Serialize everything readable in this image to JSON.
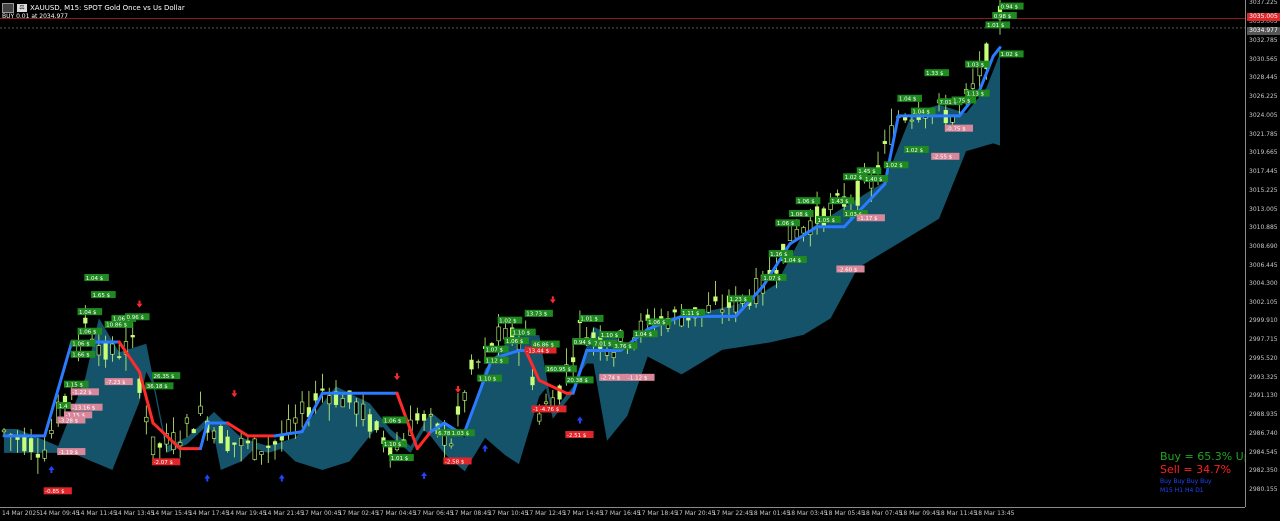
{
  "window": {
    "symbol_title": "XAUUSD, M15:  SPOT Gold Once vs Us Dollar",
    "order_line": "BUY 0.01 at 2034.977"
  },
  "price_axis": {
    "ticks": [
      "3037.225",
      "3035.005",
      "3032.785",
      "3030.565",
      "3028.445",
      "3026.225",
      "3024.005",
      "3021.785",
      "3019.665",
      "3017.445",
      "3015.225",
      "3013.005",
      "3010.885",
      "3008.690",
      "3006.445",
      "3004.300",
      "3002.105",
      "2999.910",
      "2997.715",
      "2995.520",
      "2993.325",
      "2991.130",
      "2988.935",
      "2986.740",
      "2984.545",
      "2982.350",
      "2980.155"
    ],
    "bid_tag": "3035.005",
    "ask_tag": "3034.977",
    "bid_color": "#e0262a",
    "ask_color": "#555555"
  },
  "time_axis": {
    "ticks": [
      "14 Mar 2025",
      "14 Mar 09:45",
      "14 Mar 11:45",
      "14 Mar 13:45",
      "14 Mar 15:45",
      "14 Mar 17:45",
      "14 Mar 19:45",
      "14 Mar 21:45",
      "17 Mar 00:45",
      "17 Mar 02:45",
      "17 Mar 04:45",
      "17 Mar 06:45",
      "17 Mar 08:45",
      "17 Mar 10:45",
      "17 Mar 12:45",
      "17 Mar 14:45",
      "17 Mar 16:45",
      "17 Mar 18:45",
      "17 Mar 20:45",
      "17 Mar 22:45",
      "18 Mar 01:45",
      "18 Mar 03:45",
      "18 Mar 05:45",
      "18 Mar 07:45",
      "18 Mar 09:45",
      "18 Mar 11:45",
      "18 Mar 13:45"
    ]
  },
  "stats": {
    "buy": "Buy = 65.3% Up",
    "sell": "Sell = 34.7%",
    "tf_row1": "Buy  Buy  Buy  Buy",
    "tf_row2": "M15  H1   H4   D1"
  },
  "colors": {
    "buy_label": "#1f8a1f",
    "sell_label": "#e0262a",
    "sell_label_light": "#d8889a",
    "trend_up": "#2a7bff",
    "trend_down": "#ff2a2a",
    "cloud": "#1b6f8e",
    "candle": "#c8ff78",
    "arrow_up": "#2244ff",
    "arrow_down": "#ff2a2a"
  },
  "price_scale": {
    "min": 2980.155,
    "max": 3037.225
  },
  "chart_labels": [
    {
      "text": "1.04 $",
      "kind": "buy",
      "price": 3005.0,
      "t": 12
    },
    {
      "text": "1.65 $",
      "kind": "buy",
      "price": 3003.0,
      "t": 13
    },
    {
      "text": "1.04 $",
      "kind": "buy",
      "price": 3001.0,
      "t": 11
    },
    {
      "text": "1.06 $",
      "kind": "buy",
      "price": 2998.7,
      "t": 11
    },
    {
      "text": "1.06 $",
      "kind": "buy",
      "price": 2997.3,
      "t": 10
    },
    {
      "text": "1.66 $",
      "kind": "buy",
      "price": 2996.0,
      "t": 10
    },
    {
      "text": "1.15 $",
      "kind": "buy",
      "price": 2992.5,
      "t": 9
    },
    {
      "text": "-1.22 $",
      "kind": "sell_light",
      "price": 2991.6,
      "t": 10
    },
    {
      "text": "1.4",
      "kind": "buy",
      "price": 2990.0,
      "t": 8
    },
    {
      "text": "-13.16 $",
      "kind": "sell_light",
      "price": 2989.8,
      "t": 10
    },
    {
      "text": "-1.15 $",
      "kind": "sell_light",
      "price": 2988.9,
      "t": 9
    },
    {
      "text": "-3.28 $",
      "kind": "sell_light",
      "price": 2988.3,
      "t": 8
    },
    {
      "text": "-1.19 $",
      "kind": "sell_light",
      "price": 2984.6,
      "t": 8
    },
    {
      "text": "-0.85 $",
      "kind": "sell",
      "price": 2980.0,
      "t": 6
    },
    {
      "text": "1.06 $",
      "kind": "buy",
      "price": 3000.2,
      "t": 16
    },
    {
      "text": "0.96 $",
      "kind": "buy",
      "price": 3000.4,
      "t": 18
    },
    {
      "text": "10.86 $",
      "kind": "buy",
      "price": 2999.5,
      "t": 15
    },
    {
      "text": "-7.23 $",
      "kind": "sell_light",
      "price": 2992.8,
      "t": 15
    },
    {
      "text": "26.35 $",
      "kind": "buy",
      "price": 2993.5,
      "t": 22
    },
    {
      "text": "36.18 $",
      "kind": "buy",
      "price": 2992.3,
      "t": 21
    },
    {
      "text": "-2.07 $",
      "kind": "sell",
      "price": 2983.4,
      "t": 22
    },
    {
      "text": "1.06 $",
      "kind": "buy",
      "price": 2988.3,
      "t": 56
    },
    {
      "text": "1.10 $",
      "kind": "buy",
      "price": 2985.5,
      "t": 56
    },
    {
      "text": "1.01 $",
      "kind": "buy",
      "price": 2983.9,
      "t": 57
    },
    {
      "text": "-2.58 $",
      "kind": "sell",
      "price": 2983.5,
      "t": 65
    },
    {
      "text": "6.78 $",
      "kind": "buy",
      "price": 2986.8,
      "t": 64
    },
    {
      "text": "1.03 $",
      "kind": "buy",
      "price": 2986.8,
      "t": 66
    },
    {
      "text": "1.10 $",
      "kind": "buy",
      "price": 2993.2,
      "t": 70
    },
    {
      "text": "1.12 $",
      "kind": "buy",
      "price": 2995.3,
      "t": 71
    },
    {
      "text": "1.07 $",
      "kind": "buy",
      "price": 2996.6,
      "t": 71
    },
    {
      "text": "1.06 $",
      "kind": "buy",
      "price": 2997.6,
      "t": 74
    },
    {
      "text": "1.10 $",
      "kind": "buy",
      "price": 2998.6,
      "t": 75
    },
    {
      "text": "1.02 $",
      "kind": "buy",
      "price": 3000.0,
      "t": 73
    },
    {
      "text": "13.73 $",
      "kind": "buy",
      "price": 3000.8,
      "t": 77
    },
    {
      "text": "-13.44 $",
      "kind": "sell",
      "price": 2996.5,
      "t": 77
    },
    {
      "text": "46.86 $",
      "kind": "buy",
      "price": 2997.2,
      "t": 78
    },
    {
      "text": "160.95 $",
      "kind": "buy",
      "price": 2994.3,
      "t": 80
    },
    {
      "text": "20.38 $",
      "kind": "buy",
      "price": 2993.0,
      "t": 83
    },
    {
      "text": "-1.47 $",
      "kind": "sell",
      "price": 2989.6,
      "t": 78
    },
    {
      "text": "-4.76 $",
      "kind": "sell",
      "price": 2989.6,
      "t": 79
    },
    {
      "text": "-2.51 $",
      "kind": "sell",
      "price": 2986.6,
      "t": 83
    },
    {
      "text": "1.01 $",
      "kind": "buy",
      "price": 3000.2,
      "t": 85
    },
    {
      "text": "0.94 $",
      "kind": "buy",
      "price": 2997.5,
      "t": 84
    },
    {
      "text": "7.01 $",
      "kind": "buy",
      "price": 2997.3,
      "t": 87
    },
    {
      "text": "1.10 $",
      "kind": "buy",
      "price": 2998.3,
      "t": 88
    },
    {
      "text": "3.76 $",
      "kind": "buy",
      "price": 2997.0,
      "t": 90
    },
    {
      "text": "-2.74 $",
      "kind": "sell_light",
      "price": 2993.3,
      "t": 88
    },
    {
      "text": "-1.12 $",
      "kind": "sell_light",
      "price": 2993.3,
      "t": 92
    },
    {
      "text": "1.06 $",
      "kind": "buy",
      "price": 2999.8,
      "t": 95
    },
    {
      "text": "1.04 $",
      "kind": "buy",
      "price": 2998.4,
      "t": 93
    },
    {
      "text": "1.11 $",
      "kind": "buy",
      "price": 3000.9,
      "t": 100
    },
    {
      "text": "1.23 $",
      "kind": "buy",
      "price": 3002.5,
      "t": 107
    },
    {
      "text": "1.07 $",
      "kind": "buy",
      "price": 3005.0,
      "t": 112
    },
    {
      "text": "1.16 $",
      "kind": "buy",
      "price": 3007.8,
      "t": 113
    },
    {
      "text": "1.04 $",
      "kind": "buy",
      "price": 3007.1,
      "t": 115
    },
    {
      "text": "1.06 $",
      "kind": "buy",
      "price": 3011.4,
      "t": 114
    },
    {
      "text": "1.08 $",
      "kind": "buy",
      "price": 3012.5,
      "t": 116
    },
    {
      "text": "1.06 $",
      "kind": "buy",
      "price": 3014.0,
      "t": 117
    },
    {
      "text": "1.43 $",
      "kind": "buy",
      "price": 3014.0,
      "t": 122
    },
    {
      "text": "1.03 $",
      "kind": "buy",
      "price": 3012.5,
      "t": 124
    },
    {
      "text": "1.05 $",
      "kind": "buy",
      "price": 3011.8,
      "t": 120
    },
    {
      "text": "-1.17 $",
      "kind": "sell_light",
      "price": 3012.0,
      "t": 126
    },
    {
      "text": "1.02 $",
      "kind": "buy",
      "price": 3016.8,
      "t": 124
    },
    {
      "text": "1.45 $",
      "kind": "buy",
      "price": 3017.5,
      "t": 126
    },
    {
      "text": "1.40 $",
      "kind": "buy",
      "price": 3016.6,
      "t": 127
    },
    {
      "text": "1.02 $",
      "kind": "buy",
      "price": 3018.2,
      "t": 130
    },
    {
      "text": "-2.60 $",
      "kind": "sell_light",
      "price": 3006.0,
      "t": 123
    },
    {
      "text": "1.02 $",
      "kind": "buy",
      "price": 3020.0,
      "t": 133
    },
    {
      "text": "1.33 $",
      "kind": "buy",
      "price": 3029.0,
      "t": 136
    },
    {
      "text": "1.04 $",
      "kind": "buy",
      "price": 3026.0,
      "t": 132
    },
    {
      "text": "1.04 $",
      "kind": "buy",
      "price": 3024.5,
      "t": 134
    },
    {
      "text": "7.01 $",
      "kind": "buy",
      "price": 3025.6,
      "t": 138
    },
    {
      "text": "1.75 $",
      "kind": "buy",
      "price": 3025.8,
      "t": 140
    },
    {
      "text": "1.13 $",
      "kind": "buy",
      "price": 3026.6,
      "t": 142
    },
    {
      "text": "1.03 $",
      "kind": "buy",
      "price": 3030.0,
      "t": 142
    },
    {
      "text": "-0.75 $",
      "kind": "sell_light",
      "price": 3022.5,
      "t": 139
    },
    {
      "text": "-2.55 $",
      "kind": "sell_light",
      "price": 3019.2,
      "t": 137
    },
    {
      "text": "0.94 $",
      "kind": "buy",
      "price": 3036.8,
      "t": 147
    },
    {
      "text": "0.98 $",
      "kind": "buy",
      "price": 3035.7,
      "t": 146
    },
    {
      "text": "1.01 $",
      "kind": "buy",
      "price": 3034.6,
      "t": 145
    },
    {
      "text": "1.02 $",
      "kind": "buy",
      "price": 3031.2,
      "t": 147
    }
  ],
  "arrows": [
    {
      "dir": "down",
      "t": 20,
      "price": 3002.0
    },
    {
      "dir": "down",
      "t": 34,
      "price": 2991.5
    },
    {
      "dir": "down",
      "t": 58,
      "price": 2993.5
    },
    {
      "dir": "down",
      "t": 67,
      "price": 2992.0
    },
    {
      "dir": "down",
      "t": 81,
      "price": 3002.5
    },
    {
      "dir": "up",
      "t": 7,
      "price": 2982.5
    },
    {
      "dir": "up",
      "t": 30,
      "price": 2981.5
    },
    {
      "dir": "up",
      "t": 41,
      "price": 2981.5
    },
    {
      "dir": "up",
      "t": 62,
      "price": 2981.8
    },
    {
      "dir": "up",
      "t": 71,
      "price": 2985.0
    },
    {
      "dir": "up",
      "t": 85,
      "price": 2988.3
    }
  ]
}
